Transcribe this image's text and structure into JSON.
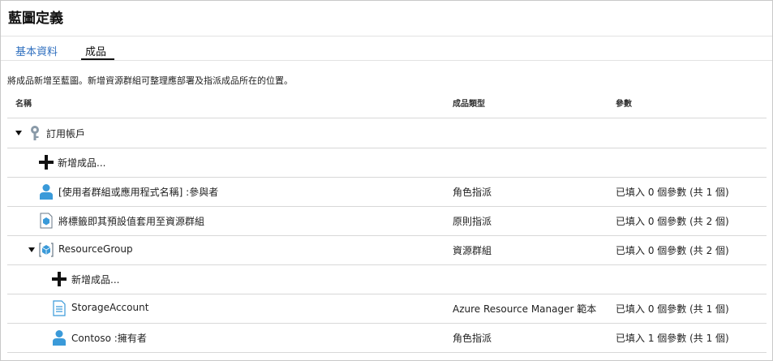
{
  "window": {
    "title": "藍圖定義"
  },
  "tabs": [
    {
      "label": "基本資料",
      "active": false
    },
    {
      "label": "成品",
      "active": true
    }
  ],
  "description": "將成品新增至藍圖。新增資源群組可整理應部署及指派成品所在的位置。",
  "table": {
    "columns": [
      "名稱",
      "成品類型",
      "參數"
    ],
    "rows": [
      {
        "name": "訂用帳戶",
        "type": "",
        "params": "",
        "icon": "key-icon"
      },
      {
        "name": "新增成品...",
        "type": "",
        "params": "",
        "icon": "plus-icon"
      },
      {
        "name": "[使用者群組或應用程式名稱] :參與者",
        "type": "角色指派",
        "params": "已填入 0 個參數 (共 1 個)",
        "icon": "user-icon"
      },
      {
        "name": "將標籤即其預設值套用至資源群組",
        "type": "原則指派",
        "params": "已填入 0 個參數 (共 2 個)",
        "icon": "policy-icon"
      },
      {
        "name": "ResourceGroup",
        "type": "資源群組",
        "params": "已填入 0 個參數 (共 2 個)",
        "icon": "resource-group-icon"
      },
      {
        "name": "新增成品...",
        "type": "",
        "params": "",
        "icon": "plus-icon"
      },
      {
        "name": "StorageAccount",
        "type": "Azure Resource Manager 範本",
        "params": "已填入 0 個參數 (共 1 個)",
        "icon": "template-icon"
      },
      {
        "name": "Contoso :擁有者",
        "type": "角色指派",
        "params": "已填入 1 個參數 (共 1 個)",
        "icon": "user-icon"
      }
    ]
  },
  "colors": {
    "accent": "#2f6fbf",
    "icon_blue": "#3a9ad9",
    "rule": "#d8d8d8"
  }
}
